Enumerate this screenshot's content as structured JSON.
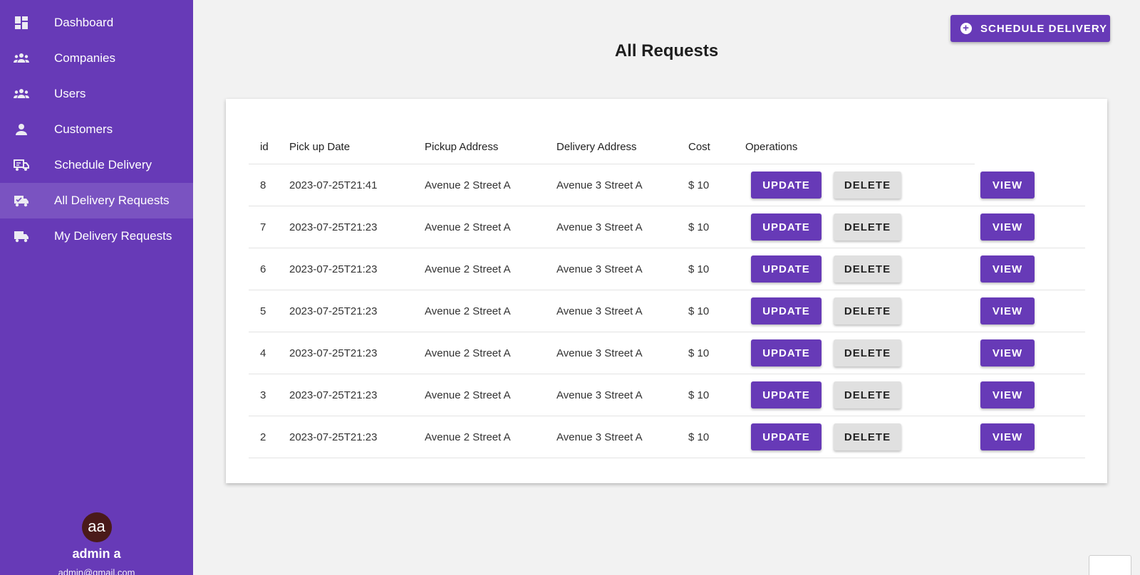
{
  "sidebar": {
    "items": [
      {
        "label": "Dashboard",
        "icon": "dashboard-icon"
      },
      {
        "label": "Companies",
        "icon": "group-icon"
      },
      {
        "label": "Users",
        "icon": "group-icon"
      },
      {
        "label": "Customers",
        "icon": "person-icon"
      },
      {
        "label": "Schedule Delivery",
        "icon": "truck-schedule-icon"
      },
      {
        "label": "All Delivery Requests",
        "icon": "truck-check-icon",
        "active": true
      },
      {
        "label": "My Delivery Requests",
        "icon": "truck-icon"
      }
    ],
    "profile": {
      "initials": "aa",
      "name": "admin a",
      "email": "admin@gmail.com"
    }
  },
  "header": {
    "schedule_button": "SCHEDULE DELIVERY",
    "title": "All Requests"
  },
  "table": {
    "columns": [
      "id",
      "Pick up Date",
      "Pickup Address",
      "Delivery Address",
      "Cost",
      "Operations"
    ],
    "rows": [
      {
        "id": "8",
        "date": "2023-07-25T21:41",
        "pickup": "Avenue 2 Street A",
        "delivery": "Avenue 3 Street A",
        "cost": "$ 10"
      },
      {
        "id": "7",
        "date": "2023-07-25T21:23",
        "pickup": "Avenue 2 Street A",
        "delivery": "Avenue 3 Street A",
        "cost": "$ 10"
      },
      {
        "id": "6",
        "date": "2023-07-25T21:23",
        "pickup": "Avenue 2 Street A",
        "delivery": "Avenue 3 Street A",
        "cost": "$ 10"
      },
      {
        "id": "5",
        "date": "2023-07-25T21:23",
        "pickup": "Avenue 2 Street A",
        "delivery": "Avenue 3 Street A",
        "cost": "$ 10"
      },
      {
        "id": "4",
        "date": "2023-07-25T21:23",
        "pickup": "Avenue 2 Street A",
        "delivery": "Avenue 3 Street A",
        "cost": "$ 10"
      },
      {
        "id": "3",
        "date": "2023-07-25T21:23",
        "pickup": "Avenue 2 Street A",
        "delivery": "Avenue 3 Street A",
        "cost": "$ 10"
      },
      {
        "id": "2",
        "date": "2023-07-25T21:23",
        "pickup": "Avenue 2 Street A",
        "delivery": "Avenue 3 Street A",
        "cost": "$ 10"
      }
    ],
    "buttons": {
      "update": "UPDATE",
      "delete": "DELETE",
      "view": "VIEW"
    }
  },
  "colors": {
    "primary": "#673ab7",
    "background": "#f2f2f2",
    "delete_button": "#e0e0e0"
  }
}
